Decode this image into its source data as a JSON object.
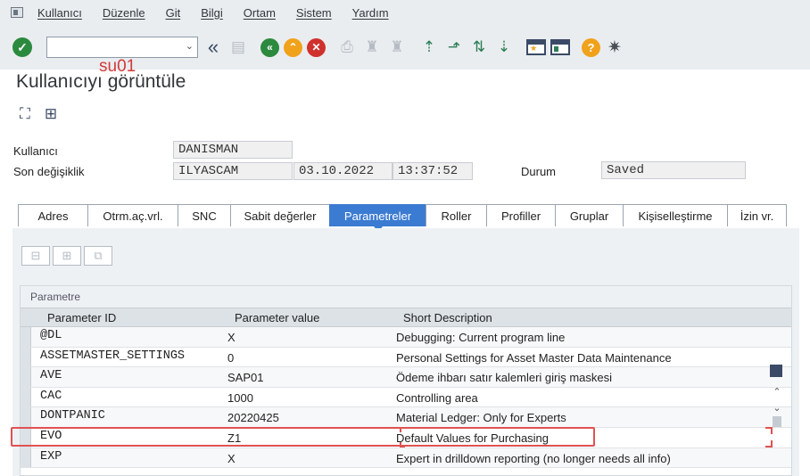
{
  "menu": [
    "Kullanıcı",
    "Düzenle",
    "Git",
    "Bilgi",
    "Ortam",
    "Sistem",
    "Yardım"
  ],
  "toolbar": {
    "command_value": "",
    "annotation": "su01"
  },
  "title": "Kullanıcıyı görüntüle",
  "header": {
    "user_label": "Kullanıcı",
    "user_value": "DANISMAN",
    "last_change_label": "Son değişiklik",
    "changed_by": "ILYASCAM",
    "date": "03.10.2022",
    "time": "13:37:52",
    "status_label": "Durum",
    "status_value": "Saved"
  },
  "tabs": [
    "Adres",
    "Otrm.aç.vrl.",
    "SNC",
    "Sabit değerler",
    "Parametreler",
    "Roller",
    "Profiller",
    "Gruplar",
    "Kişiselleştirme",
    "İzin vr."
  ],
  "active_tab": "Parametreler",
  "grid": {
    "title": "Parametre",
    "columns": [
      "Parameter ID",
      "Parameter value",
      "Short Description"
    ],
    "rows": [
      {
        "id": "@DL",
        "value": "X",
        "desc": "Debugging: Current program line"
      },
      {
        "id": "ASSETMASTER_SETTINGS",
        "value": "0",
        "desc": "Personal Settings for Asset Master Data Maintenance"
      },
      {
        "id": "AVE",
        "value": "SAP01",
        "desc": "Ödeme ihbarı satır kalemleri giriş maskesi"
      },
      {
        "id": "CAC",
        "value": "1000",
        "desc": "Controlling area"
      },
      {
        "id": "DONTPANIC",
        "value": "20220425",
        "desc": "Material Ledger: Only for Experts"
      },
      {
        "id": "EVO",
        "value": "Z1",
        "desc": "Default Values for Purchasing"
      },
      {
        "id": "EXP",
        "value": "X",
        "desc": "Expert in drilldown reporting (no longer needs all info)"
      }
    ]
  },
  "accent": "#3b7bd1",
  "highlight_color": "#e05252"
}
